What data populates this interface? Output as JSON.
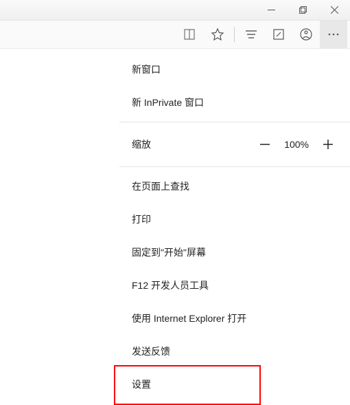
{
  "titlebar": {
    "minimize_name": "minimize",
    "maximize_name": "maximize",
    "close_name": "close"
  },
  "toolbar": {
    "reading_name": "reading-list",
    "favorite_name": "favorite",
    "hub_name": "hub",
    "note_name": "web-note",
    "share_name": "share",
    "more_name": "more"
  },
  "menu": {
    "new_window": "新窗口",
    "new_inprivate": "新 InPrivate 窗口",
    "zoom_label": "缩放",
    "zoom_value": "100%",
    "find": "在页面上查找",
    "print": "打印",
    "pin_to_start": "固定到\"开始\"屏幕",
    "dev_tools": "F12 开发人员工具",
    "open_in_ie": "使用 Internet Explorer 打开",
    "send_feedback": "发送反馈",
    "settings": "设置"
  }
}
